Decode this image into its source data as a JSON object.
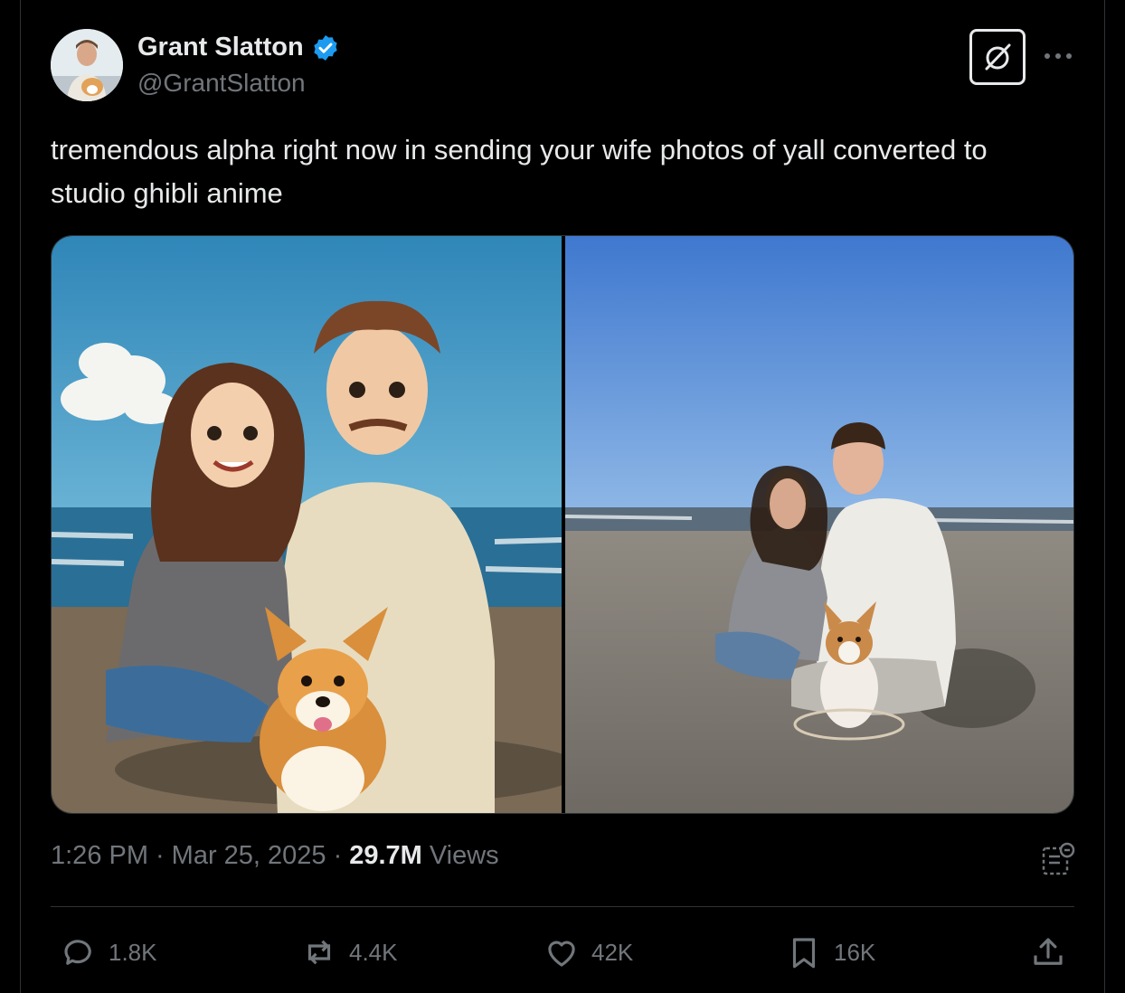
{
  "author": {
    "name": "Grant Slatton",
    "handle": "@GrantSlatton",
    "verified": true
  },
  "tweet": {
    "text": "tremendous alpha right now in sending your wife photos of yall converted to studio ghibli anime"
  },
  "media": {
    "images": [
      "anime-style-beach-portrait",
      "beach-photo-couple-with-corgi"
    ]
  },
  "meta": {
    "time": "1:26 PM",
    "sep1": "·",
    "date": "Mar 25, 2025",
    "sep2": "·",
    "views_count": "29.7M",
    "views_label": "Views"
  },
  "actions": {
    "replies": "1.8K",
    "reposts": "4.4K",
    "likes": "42K",
    "bookmarks": "16K"
  },
  "colors": {
    "background": "#000000",
    "text": "#e7e9ea",
    "muted": "#71767b",
    "verified": "#1d9bf0",
    "border": "#2f3336"
  },
  "icons": [
    "verified-badge-icon",
    "grok-icon",
    "more-icon",
    "analytics-icon",
    "reply-icon",
    "repost-icon",
    "like-icon",
    "bookmark-icon",
    "share-icon"
  ]
}
